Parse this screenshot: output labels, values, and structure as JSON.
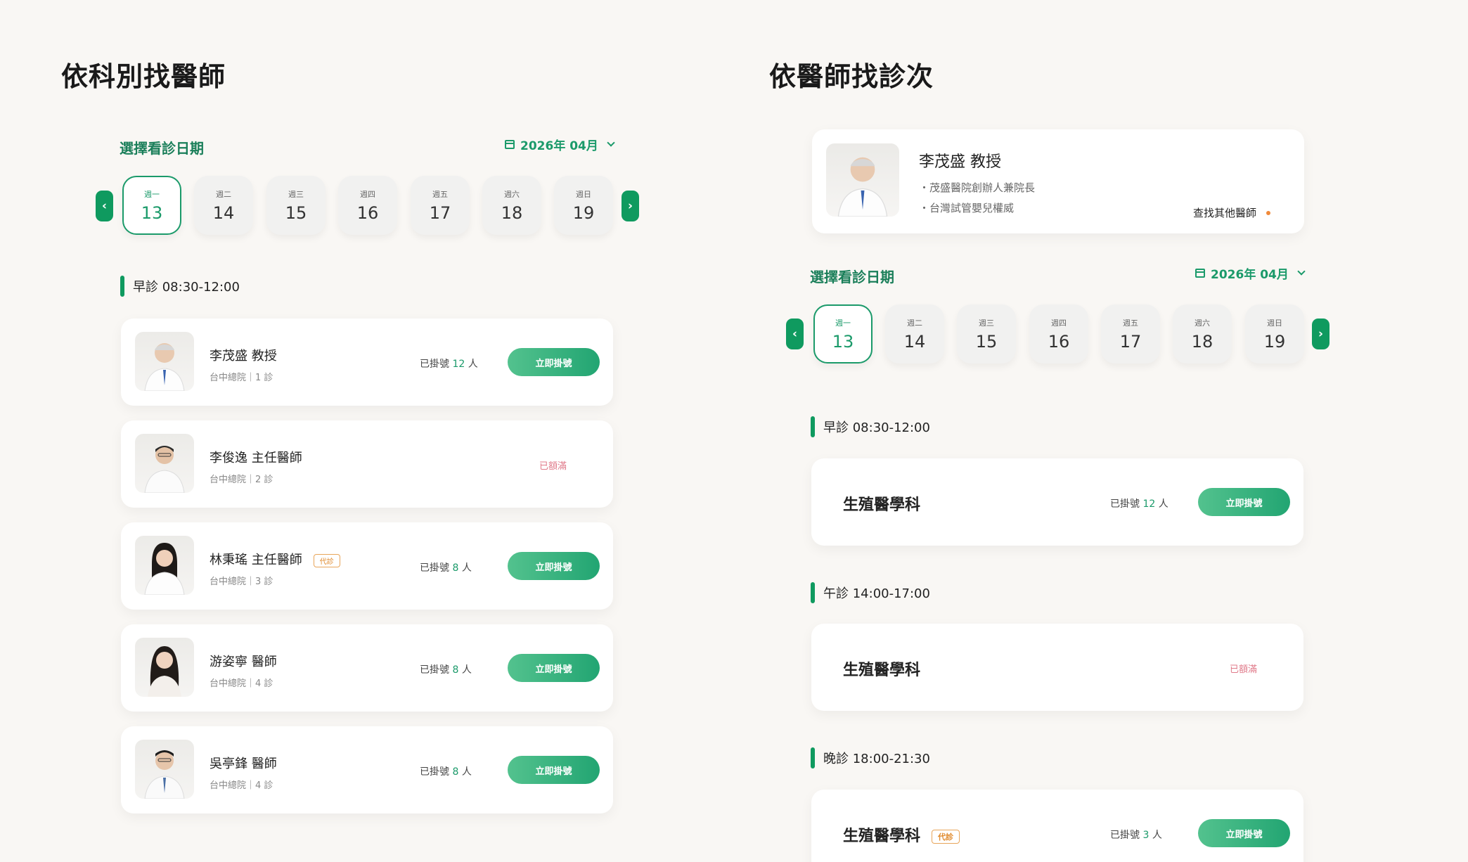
{
  "left": {
    "title": "依科別找醫師",
    "date_label": "選擇看診日期",
    "month": "2026年 04月",
    "prev_icon": "‹",
    "next_icon": "›",
    "days": [
      {
        "wd": "週一",
        "dn": "13"
      },
      {
        "wd": "週二",
        "dn": "14"
      },
      {
        "wd": "週三",
        "dn": "15"
      },
      {
        "wd": "週四",
        "dn": "16"
      },
      {
        "wd": "週五",
        "dn": "17"
      },
      {
        "wd": "週六",
        "dn": "18"
      },
      {
        "wd": "週日",
        "dn": "19"
      }
    ],
    "session": "早診 08:30-12:00",
    "doctors": [
      {
        "name": "李茂盛 教授",
        "sub": "台中總院｜1 診",
        "reg_pre": "已掛號",
        "reg_num": "12",
        "reg_post": "人",
        "btn": "立即掛號",
        "tag": ""
      },
      {
        "name": "李俊逸 主任醫師",
        "sub": "台中總院｜2 診",
        "full": "已額滿",
        "tag": ""
      },
      {
        "name": "林秉瑤 主任醫師",
        "sub": "台中總院｜3 診",
        "reg_pre": "已掛號",
        "reg_num": "8",
        "reg_post": "人",
        "btn": "立即掛號",
        "tag": "代診"
      },
      {
        "name": "游姿寧 醫師",
        "sub": "台中總院｜4 診",
        "reg_pre": "已掛號",
        "reg_num": "8",
        "reg_post": "人",
        "btn": "立即掛號",
        "tag": ""
      },
      {
        "name": "吳亭鋒 醫師",
        "sub": "台中總院｜4 診",
        "reg_pre": "已掛號",
        "reg_num": "8",
        "reg_post": "人",
        "btn": "立即掛號",
        "tag": ""
      }
    ]
  },
  "right": {
    "title": "依醫師找診次",
    "profile": {
      "name": "李茂盛 教授",
      "line1": "・茂盛醫院創辦人兼院長",
      "line2": "・台灣試管嬰兒權威",
      "find_other": "查找其他醫師"
    },
    "date_label": "選擇看診日期",
    "month": "2026年 04月",
    "prev_icon": "‹",
    "next_icon": "›",
    "days": [
      {
        "wd": "週一",
        "dn": "13"
      },
      {
        "wd": "週二",
        "dn": "14"
      },
      {
        "wd": "週三",
        "dn": "15"
      },
      {
        "wd": "週四",
        "dn": "16"
      },
      {
        "wd": "週五",
        "dn": "17"
      },
      {
        "wd": "週六",
        "dn": "18"
      },
      {
        "wd": "週日",
        "dn": "19"
      }
    ],
    "sessions": [
      {
        "label": "早診 08:30-12:00",
        "dept": "生殖醫學科",
        "reg_pre": "已掛號",
        "reg_num": "12",
        "reg_post": "人",
        "btn": "立即掛號",
        "tag": ""
      },
      {
        "label": "午診 14:00-17:00",
        "dept": "生殖醫學科",
        "full": "已額滿",
        "tag": ""
      },
      {
        "label": "晚診 18:00-21:30",
        "dept": "生殖醫學科",
        "reg_pre": "已掛號",
        "reg_num": "3",
        "reg_post": "人",
        "btn": "立即掛號",
        "tag": "代診"
      }
    ]
  },
  "colors": {
    "accent": "#1b9a6a",
    "nav_arrow": "#0f9a5f",
    "full": "#e07a8a",
    "substitute_tag": "#e08a2c",
    "background": "#f9f7f4"
  }
}
